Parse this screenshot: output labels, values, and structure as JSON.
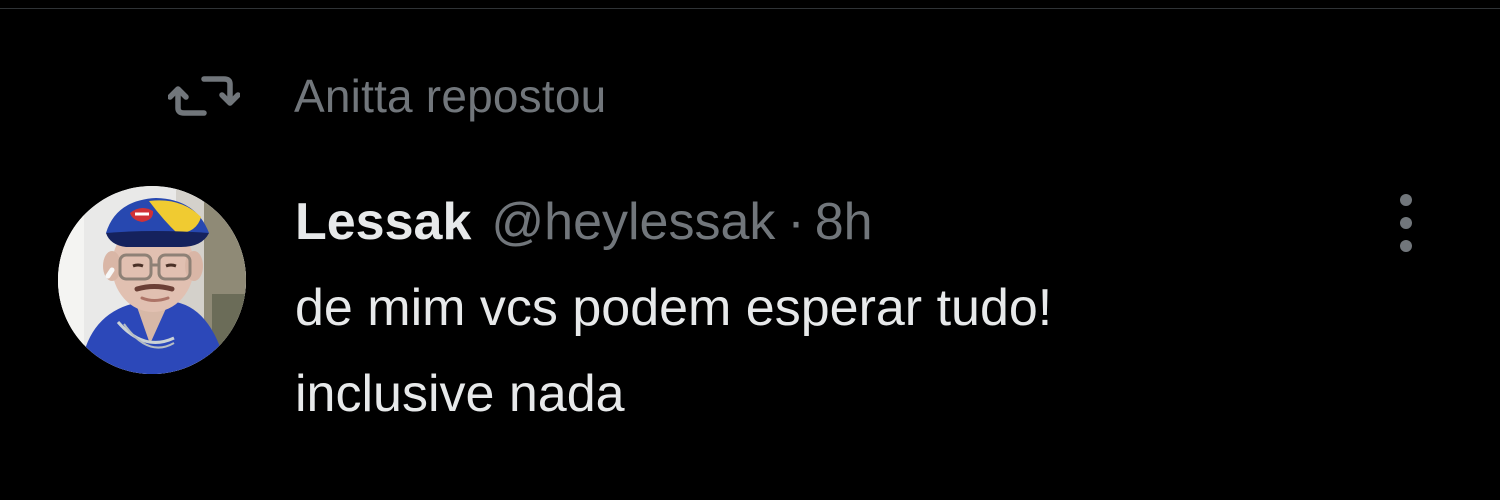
{
  "repost": {
    "label": "Anitta repostou",
    "icon": "repost-icon"
  },
  "tweet": {
    "avatar_icon": "user-avatar",
    "display_name": "Lessak",
    "handle": "@heylessak",
    "separator": "·",
    "timestamp": "8h",
    "more_icon": "more-options-icon",
    "text_lines": [
      "de mim vcs podem esperar tudo!",
      "inclusive nada"
    ]
  },
  "colors": {
    "background": "#000000",
    "primary_text": "#e7e9ea",
    "secondary_text": "#71767b",
    "divider": "#2f3336"
  }
}
